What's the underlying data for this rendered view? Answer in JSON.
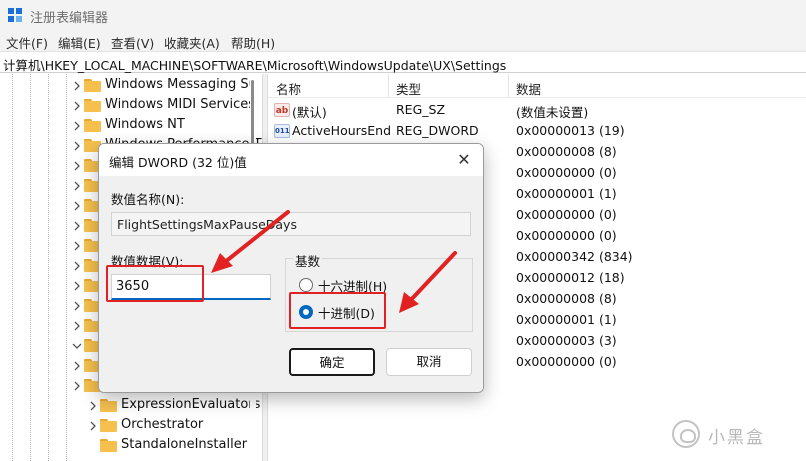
{
  "window": {
    "title": "注册表编辑器"
  },
  "menu": [
    "文件(F)",
    "编辑(E)",
    "查看(V)",
    "收藏夹(A)",
    "帮助(H)"
  ],
  "address": "计算机\\HKEY_LOCAL_MACHINE\\SOFTWARE\\Microsoft\\WindowsUpdate\\UX\\Settings",
  "tree": {
    "items": [
      {
        "label": "Windows Messaging Su"
      },
      {
        "label": "Windows MIDI Services"
      },
      {
        "label": "Windows NT"
      },
      {
        "label": "Windows Performance T"
      },
      {
        "label": ""
      },
      {
        "label": ""
      },
      {
        "label": ""
      },
      {
        "label": ""
      },
      {
        "label": ""
      },
      {
        "label": ""
      },
      {
        "label": ""
      },
      {
        "label": ""
      },
      {
        "label": ""
      },
      {
        "label": ""
      },
      {
        "label": ""
      },
      {
        "label": ""
      },
      {
        "label": "ExpressionEvaluators"
      },
      {
        "label": "Orchestrator"
      },
      {
        "label": "StandaloneInstaller"
      }
    ]
  },
  "list": {
    "columns": [
      "名称",
      "类型",
      "数据"
    ],
    "rows": [
      {
        "icon": "ab",
        "name": "(默认)",
        "type": "REG_SZ",
        "data": "(数值未设置)"
      },
      {
        "icon": "011",
        "name": "ActiveHoursEnd",
        "type": "REG_DWORD",
        "data": "0x00000013 (19)"
      },
      {
        "icon": "",
        "name": "",
        "type": "",
        "data": "0x00000008 (8)"
      },
      {
        "icon": "",
        "name": "",
        "type": "",
        "data": "0x00000000 (0)"
      },
      {
        "icon": "",
        "name": "",
        "type": "",
        "data": "0x00000001 (1)"
      },
      {
        "icon": "",
        "name": "",
        "type": "",
        "data": "0x00000000 (0)"
      },
      {
        "icon": "",
        "name": "",
        "type": "",
        "data": "0x00000000 (0)"
      },
      {
        "icon": "",
        "name": "",
        "type": "",
        "data": "0x00000342 (834)"
      },
      {
        "icon": "",
        "name": "",
        "type": "",
        "data": "0x00000012 (18)"
      },
      {
        "icon": "",
        "name": "",
        "type": "",
        "data": "0x00000008 (8)"
      },
      {
        "icon": "",
        "name": "",
        "type": "",
        "data": "0x00000001 (1)"
      },
      {
        "icon": "",
        "name": "",
        "type": "",
        "data": "0x00000003 (3)"
      },
      {
        "icon": "",
        "name": "",
        "type": "",
        "data": "0x00000000 (0)"
      }
    ]
  },
  "dialog": {
    "title": "编辑 DWORD (32 位)值",
    "close_icon": "✕",
    "value_name_label": "数值名称(N):",
    "value_name": "FlightSettingsMaxPauseDays",
    "value_data_label": "数值数据(V):",
    "value_data": "3650",
    "base_label": "基数",
    "base_options": [
      {
        "label": "十六进制(H)",
        "selected": false
      },
      {
        "label": "十进制(D)",
        "selected": true
      }
    ],
    "ok_label": "确定",
    "cancel_label": "取消"
  },
  "watermark": {
    "text": "小黑盒"
  },
  "colors": {
    "accent": "#0067c0",
    "annotation": "#e22222",
    "folder": "#f5c04e"
  }
}
